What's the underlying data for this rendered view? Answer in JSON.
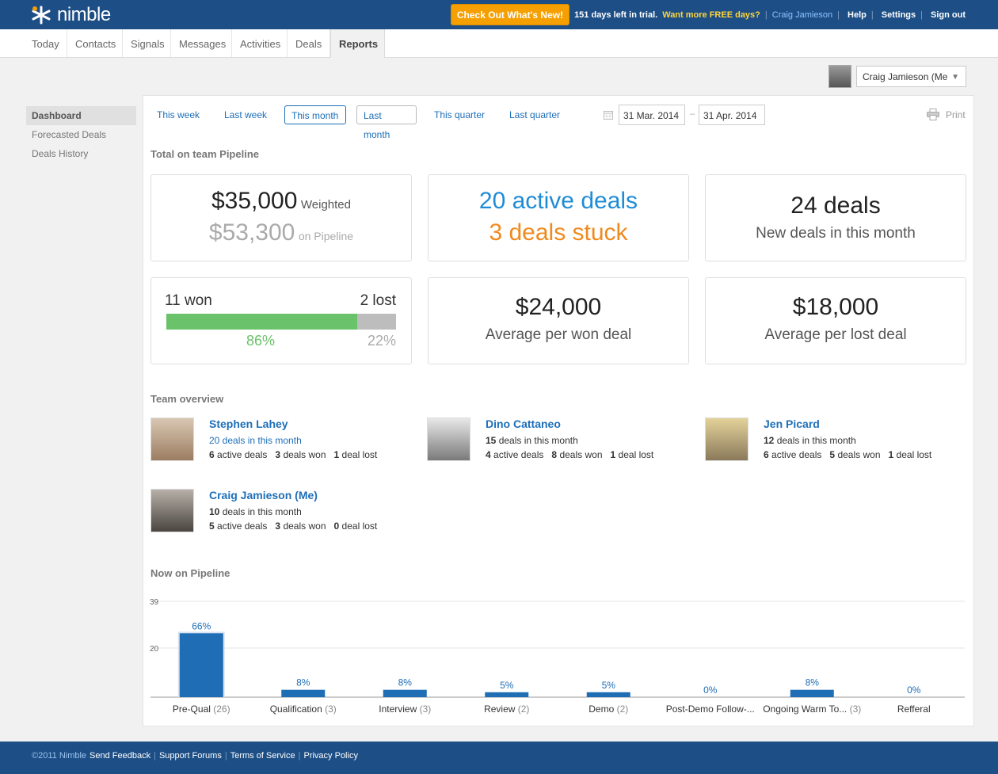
{
  "app": {
    "name": "nimble"
  },
  "topbar": {
    "whats_new": "Check Out What's New!",
    "trial_text": "151 days left in trial.",
    "more_free": "Want more FREE days?",
    "user_name": "Craig Jamieson",
    "help": "Help",
    "settings": "Settings",
    "sign_out": "Sign out"
  },
  "nav": {
    "tabs": [
      "Today",
      "Contacts",
      "Signals",
      "Messages",
      "Activities",
      "Deals",
      "Reports"
    ],
    "active": "Reports"
  },
  "user_select": {
    "value": "Craig Jamieson (Me"
  },
  "sidebar": {
    "items": [
      "Dashboard",
      "Forecasted Deals",
      "Deals History"
    ],
    "active": "Dashboard"
  },
  "periods": {
    "items": [
      "This week",
      "Last week",
      "This month",
      "Last month",
      "This quarter",
      "Last quarter"
    ],
    "selected": "This month"
  },
  "dates": {
    "from": "31 Mar. 2014",
    "dash": "–",
    "to": "31 Apr. 2014"
  },
  "print_label": "Print",
  "pipeline_total": {
    "title": "Total on team Pipeline",
    "weighted_value": "$35,000",
    "weighted_label": "Weighted",
    "pipeline_value": "$53,300",
    "pipeline_label": "on Pipeline",
    "active_deals": "20 active deals",
    "stuck_deals": "3 deals stuck",
    "new_deals_value": "24 deals",
    "new_deals_label": "New deals in this month",
    "won_label": "11 won",
    "lost_label": "2 lost",
    "won_pct": "86%",
    "lost_pct": "22%",
    "won_fraction": 0.83,
    "avg_won_value": "$24,000",
    "avg_won_label": "Average per won deal",
    "avg_lost_value": "$18,000",
    "avg_lost_label": "Average per lost deal"
  },
  "team": {
    "title": "Team overview",
    "members": [
      {
        "name": "Stephen Lahey",
        "month": "20 deals in this month",
        "active": "6",
        "won": "3",
        "lost": "1",
        "lost_label": "deal lost"
      },
      {
        "name": "Dino Cattaneo",
        "month_count": "15",
        "month_label": "deals in this month",
        "active": "4",
        "won": "8",
        "lost": "1",
        "lost_label": "deal lost"
      },
      {
        "name": "Jen Picard",
        "month_count": "12",
        "month_label": "deals in this month",
        "active": "6",
        "won": "5",
        "lost": "1",
        "lost_label": "deal lost"
      },
      {
        "name": "Craig Jamieson (Me)",
        "month_count": "10",
        "month_label": "deals in this month",
        "active": "5",
        "won": "3",
        "lost": "0",
        "lost_label": "deal lost"
      }
    ],
    "active_label": "active deals",
    "won_label": "deals won"
  },
  "chart_data": {
    "type": "bar",
    "title": "Now on Pipeline",
    "categories": [
      "Pre-Qual",
      "Qualification",
      "Interview",
      "Review",
      "Demo",
      "Post-Demo Follow-...",
      "Ongoing Warm To...",
      "Refferal"
    ],
    "counts": [
      "(26)",
      "(3)",
      "(3)",
      "(2)",
      "(2)",
      "",
      "(3)",
      ""
    ],
    "values": [
      26,
      3,
      3,
      2,
      2,
      0,
      3,
      0
    ],
    "percent_labels": [
      "66%",
      "8%",
      "8%",
      "5%",
      "5%",
      "0%",
      "8%",
      "0%"
    ],
    "ylim": [
      0,
      39
    ],
    "yticks": [
      "39",
      "20"
    ],
    "grid": true,
    "bar_color": "#1f6db5"
  },
  "footer": {
    "copyright": "©2011 Nimble",
    "links": [
      "Send Feedback",
      "Support Forums",
      "Terms of Service",
      "Privacy Policy"
    ],
    "separator": "|"
  }
}
